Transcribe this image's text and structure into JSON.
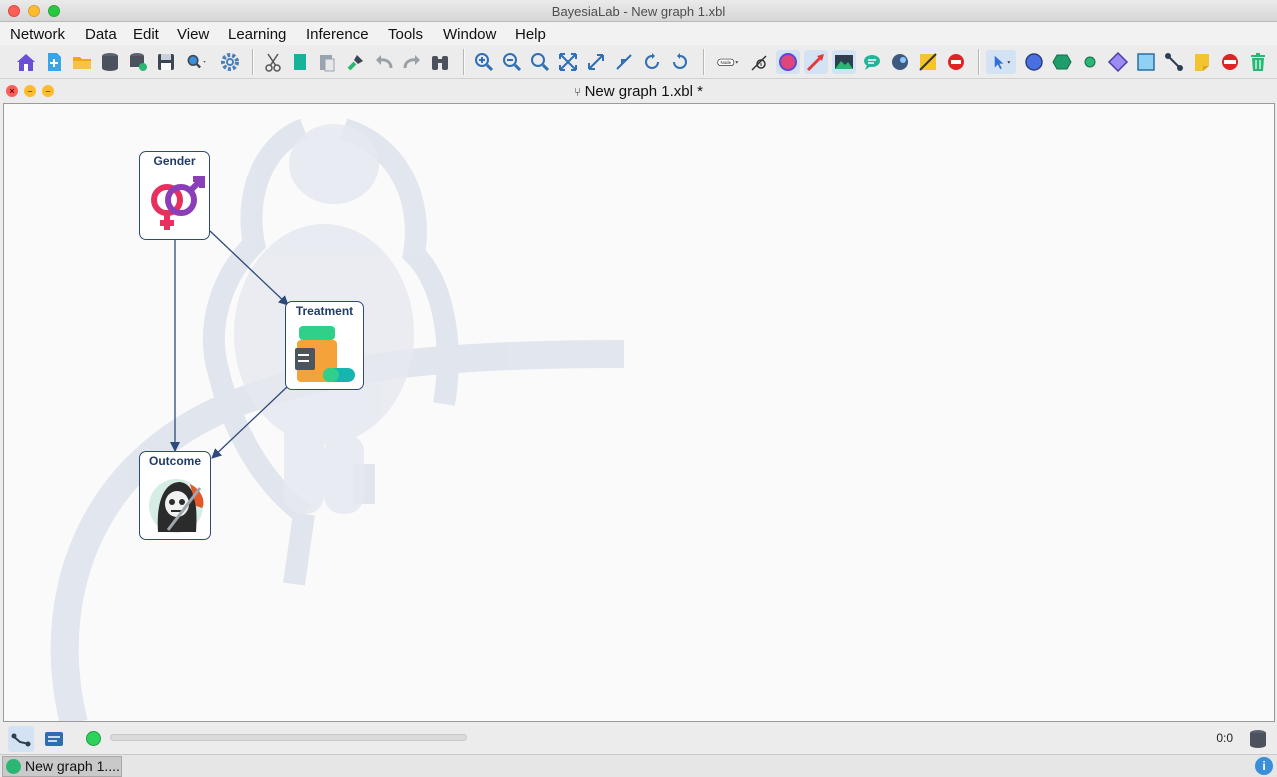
{
  "window": {
    "title": "BayesiaLab - New graph 1.xbl"
  },
  "menu": [
    "Network",
    "Data",
    "Edit",
    "View",
    "Learning",
    "Inference",
    "Tools",
    "Window",
    "Help"
  ],
  "document": {
    "title": "New graph 1.xbl *"
  },
  "toolbar": {
    "node_label": "Node",
    "icons": [
      "home-icon",
      "new-icon",
      "open-folder-icon",
      "database-icon",
      "database-link-icon",
      "save-icon",
      "search-db-icon",
      "settings-gear-icon",
      "cut-icon",
      "copy-icon",
      "paste-icon",
      "format-brush-icon",
      "undo-icon",
      "redo-icon",
      "binoculars-icon",
      "zoom-in-icon",
      "zoom-out-icon",
      "zoom-reset-icon",
      "fit-icon",
      "expand-icon",
      "shrink-icon",
      "rotate-left-icon",
      "rotate-right-icon",
      "node-dropdown-icon",
      "info-icon",
      "node-color-icon",
      "arc-color-icon",
      "image-icon",
      "comment-icon",
      "globe-icon",
      "note-icon",
      "no-entry-icon",
      "select-arrow-icon",
      "circle-node-icon",
      "hexagon-node-icon",
      "small-node-icon",
      "diamond-node-icon",
      "square-node-icon",
      "arc-tool-icon",
      "sticky-note-icon",
      "delete-icon",
      "trash-icon"
    ]
  },
  "graph": {
    "nodes": [
      {
        "id": "gender",
        "label": "Gender"
      },
      {
        "id": "treatment",
        "label": "Treatment"
      },
      {
        "id": "outcome",
        "label": "Outcome"
      }
    ],
    "arcs": [
      {
        "from": "gender",
        "to": "treatment"
      },
      {
        "from": "gender",
        "to": "outcome"
      },
      {
        "from": "treatment",
        "to": "outcome"
      }
    ]
  },
  "status": {
    "coordinates": "0:0",
    "progress": 0
  },
  "taskbar": {
    "tab_label": "New graph 1...."
  },
  "colors": {
    "node_border": "#2e4a7a",
    "arc": "#2e4a7a",
    "canvas": "#fafafa"
  }
}
